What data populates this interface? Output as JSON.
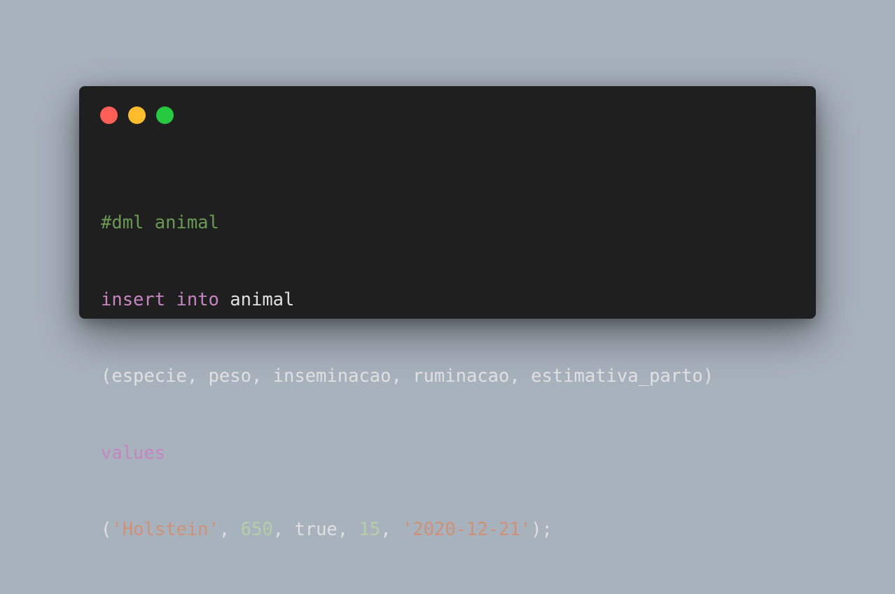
{
  "colors": {
    "background": "#a8b2bd",
    "window": "#1f1f1f",
    "close": "#ff5f56",
    "minimize": "#ffbd2e",
    "maximize": "#27c93f",
    "comment": "#6a9955",
    "keyword": "#c586c0",
    "string": "#ce9178",
    "number": "#b5cea8",
    "text": "#e0e0e0"
  },
  "code": {
    "line1": {
      "comment": "#dml animal"
    },
    "line2": {
      "kw_insert": "insert",
      "sp1": " ",
      "kw_into": "into",
      "table": " animal"
    },
    "line3": {
      "text": "(especie, peso, inseminacao, ruminacao, estimativa_parto)"
    },
    "line4": {
      "kw_values": "values"
    },
    "line5": {
      "open": "(",
      "str1": "'Holstein'",
      "sep1": ", ",
      "num1": "650",
      "sep2": ", true, ",
      "num2": "15",
      "sep3": ", ",
      "str2": "'2020-12-21'",
      "close": ");"
    }
  }
}
